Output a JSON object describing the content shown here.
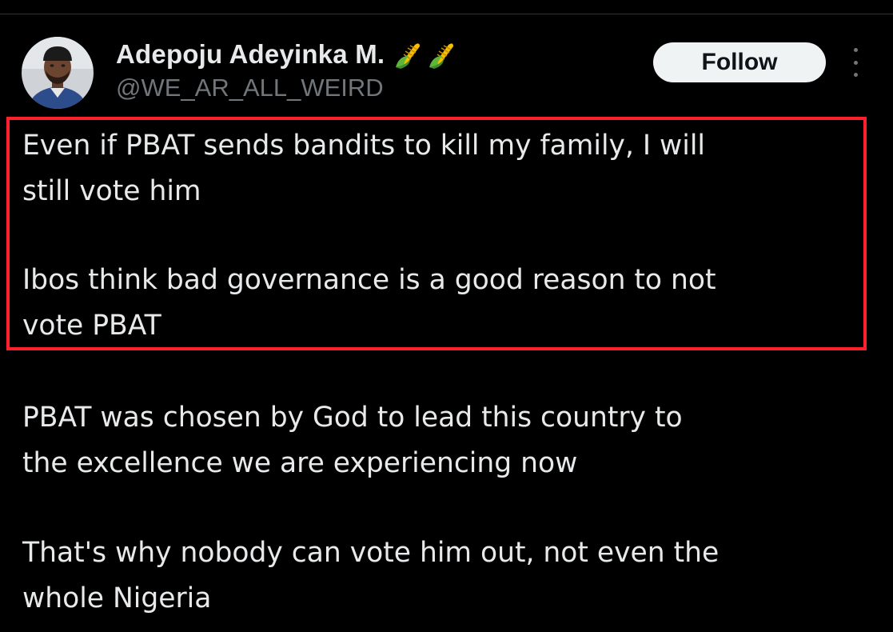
{
  "author": {
    "display_name": "Adepoju Adeyinka M.",
    "handle": "@WE_AR_ALL_WEIRD",
    "name_emojis": [
      "corn-emoji",
      "corn-emoji"
    ]
  },
  "actions": {
    "follow_label": "Follow"
  },
  "tweet": {
    "highlighted": [
      [
        "Even if PBAT sends bandits to kill my family, I will",
        "still vote him"
      ],
      [
        "Ibos think bad governance is a good reason to not",
        "vote PBAT"
      ]
    ],
    "rest": [
      [
        "PBAT was chosen by God to lead this country to",
        "the excellence we are experiencing now"
      ],
      [
        "That's why nobody can vote him out, not even the",
        "whole Nigeria"
      ]
    ]
  },
  "colors": {
    "background": "#000000",
    "text": "#e7e9ea",
    "muted": "#71767b",
    "highlight_border": "#ff1f2e",
    "follow_bg": "#eff3f4"
  }
}
